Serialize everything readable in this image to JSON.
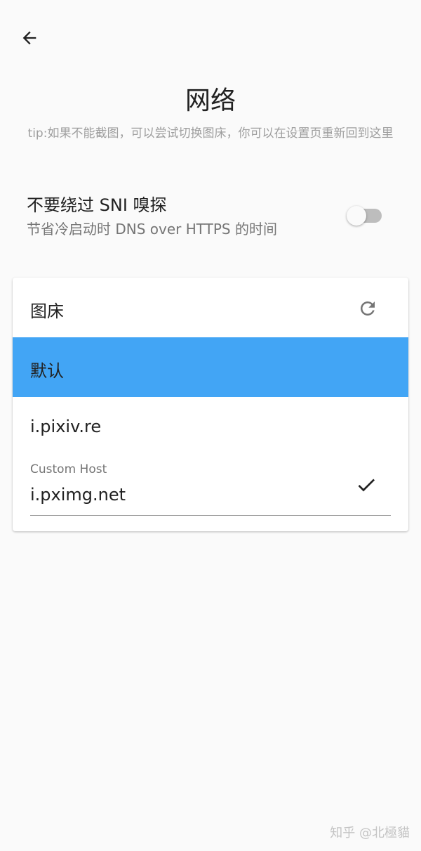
{
  "header": {
    "back_icon": "arrow-back-icon",
    "title": "网络",
    "tip": "tip:如果不能截图，可以尝试切换图床，你可以在设置页重新回到这里"
  },
  "sni_setting": {
    "title": "不要绕过 SNI 嗅探",
    "subtitle": "节省冷启动时 DNS over HTTPS 的时间",
    "enabled": false
  },
  "image_host": {
    "title": "图床",
    "refresh_icon": "refresh-icon",
    "options": [
      {
        "label": "默认",
        "selected": true
      },
      {
        "label": "i.pixiv.re",
        "selected": false
      }
    ],
    "custom_host": {
      "label": "Custom Host",
      "value": "i.pximg.net",
      "confirm_icon": "check-icon"
    }
  },
  "colors": {
    "selected_bg": "#42a5f5",
    "background": "#fafafa"
  },
  "watermark": "知乎 @北極貓"
}
